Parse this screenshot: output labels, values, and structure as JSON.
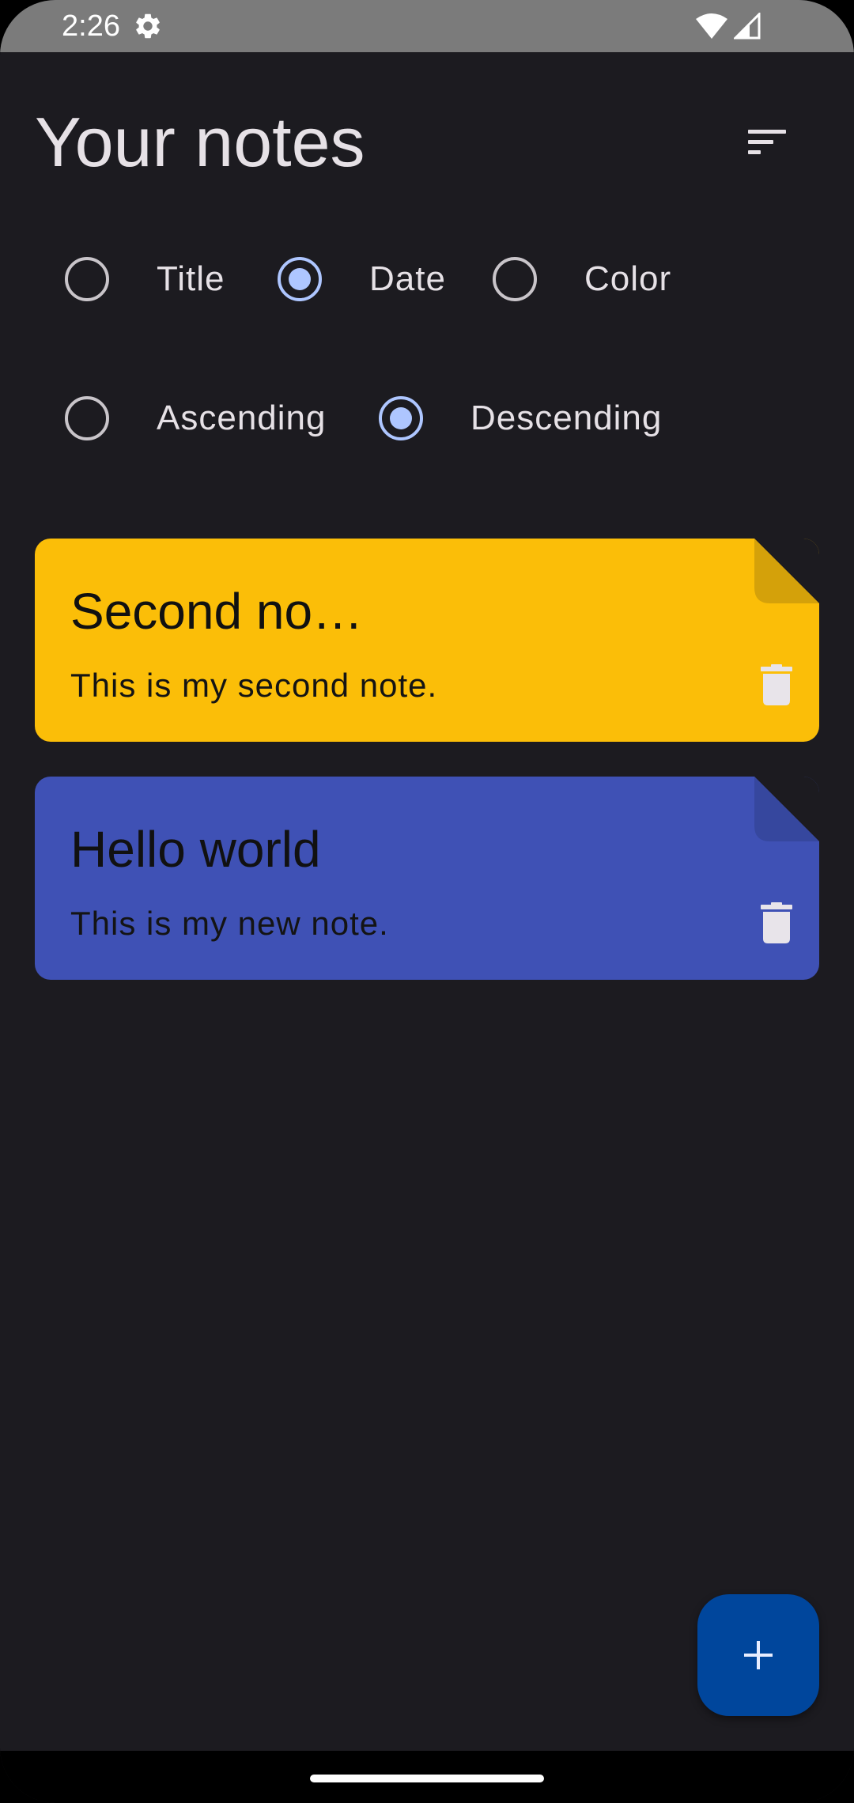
{
  "status_bar": {
    "time": "2:26",
    "icons": [
      "gear-icon",
      "wifi-icon",
      "cellular-signal-icon"
    ],
    "background_color": "#7b7b7b"
  },
  "header": {
    "title": "Your notes",
    "sort_icon": "sort-icon"
  },
  "sort_options": {
    "order_by": [
      {
        "label": "Title",
        "selected": false
      },
      {
        "label": "Date",
        "selected": true
      },
      {
        "label": "Color",
        "selected": false
      }
    ],
    "direction": [
      {
        "label": "Ascending",
        "selected": false
      },
      {
        "label": "Descending",
        "selected": true
      }
    ],
    "selected_color": "#aec6ff"
  },
  "notes": [
    {
      "title": "Second no…",
      "content": "This is my second note.",
      "color": "#fbbe08",
      "delete_icon": "trash-icon"
    },
    {
      "title": "Hello world",
      "content": "This is my new note.",
      "color": "#3f51b5",
      "delete_icon": "trash-icon"
    }
  ],
  "fab": {
    "icon": "plus-icon",
    "color": "#00469c"
  },
  "theme": {
    "background": "#1c1b20",
    "text": "#e6e1e6"
  }
}
